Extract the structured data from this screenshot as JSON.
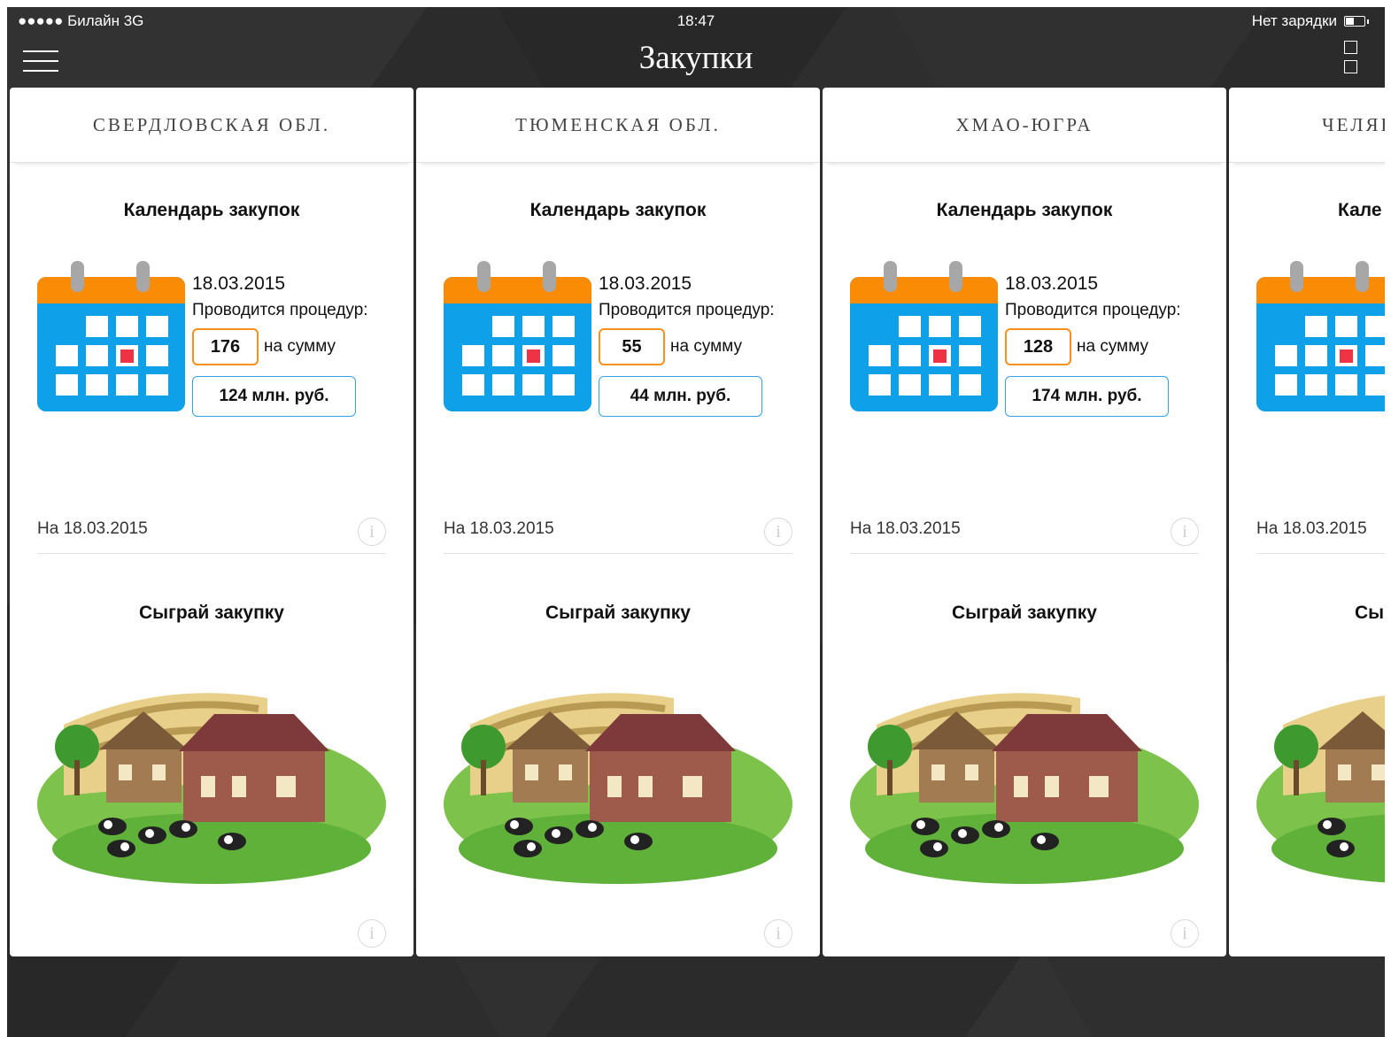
{
  "status_bar": {
    "carrier": "●●●●● Билайн  3G",
    "time": "18:47",
    "battery_text": "Нет зарядки"
  },
  "nav": {
    "title": "Закупки"
  },
  "cards": [
    {
      "region": "СВЕРДЛОВСКАЯ ОБЛ.",
      "calendar_title": "Календарь закупок",
      "date": "18.03.2015",
      "procedures_label": "Проводится процедур:",
      "count": "176",
      "sum_label": "на сумму",
      "sum": "124 млн. руб.",
      "as_of": "На 18.03.2015",
      "game_title": "Сыграй закупку"
    },
    {
      "region": "ТЮМЕНСКАЯ ОБЛ.",
      "calendar_title": "Календарь закупок",
      "date": "18.03.2015",
      "procedures_label": "Проводится процедур:",
      "count": "55",
      "sum_label": "на сумму",
      "sum": "44 млн. руб.",
      "as_of": "На 18.03.2015",
      "game_title": "Сыграй закупку"
    },
    {
      "region": "ХМАО-ЮГРА",
      "calendar_title": "Календарь закупок",
      "date": "18.03.2015",
      "procedures_label": "Проводится процедур:",
      "count": "128",
      "sum_label": "на сумму",
      "sum": "174 млн. руб.",
      "as_of": "На 18.03.2015",
      "game_title": "Сыграй закупку"
    },
    {
      "region": "ЧЕЛЯБ",
      "calendar_title": "Кале",
      "as_of": "На 18.03.2015",
      "game_title": "Сы"
    }
  ],
  "icons": {
    "menu": "hamburger-icon",
    "view": "grid-view-icon",
    "info": "info-icon",
    "info_glyph": "i"
  },
  "colors": {
    "background": "#2b2b2b",
    "calendar_blue": "#0ea0e8",
    "calendar_orange": "#f98b05",
    "count_border": "#f5921e",
    "sum_border": "#35a3e0"
  }
}
